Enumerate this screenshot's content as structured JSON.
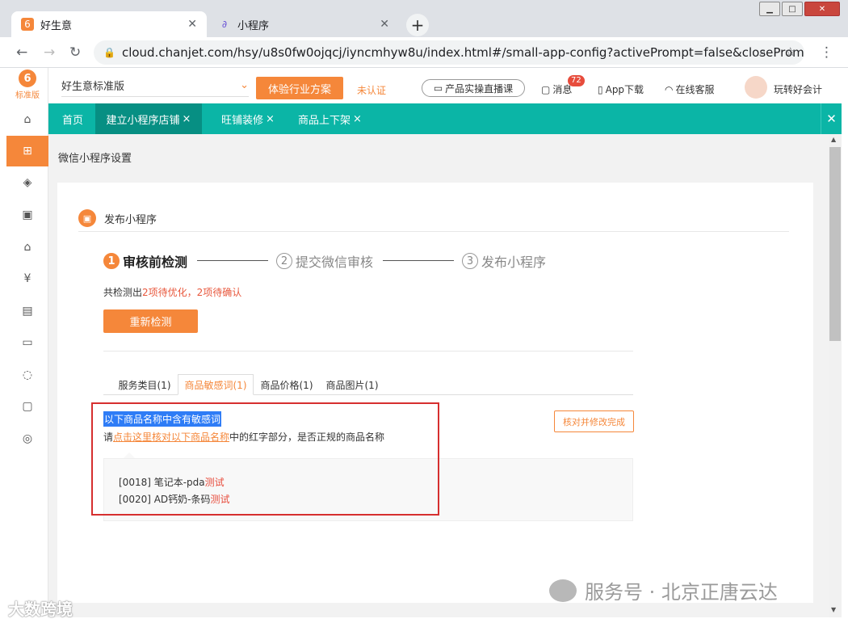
{
  "browser": {
    "tabs": [
      {
        "title": "好生意",
        "icon_text": "6"
      },
      {
        "title": "小程序",
        "icon_text": "∂"
      }
    ],
    "url": "cloud.chanjet.com/hsy/u8s0fw0ojqcj/iyncmhyw8u/index.html#/small-app-config?activePrompt=false&closeProm..."
  },
  "app": {
    "logo_label": "标准版",
    "edition": "好生意标准版",
    "trial_button": "体验行业方案",
    "unverified": "未认证",
    "live_course": "产品实操直播课",
    "messages": "消息",
    "message_count": "72",
    "app_download": "App下载",
    "online_service": "在线客服",
    "user_name": "玩转好会计"
  },
  "nav_tabs": [
    {
      "label": "首页"
    },
    {
      "label": "建立小程序店铺"
    },
    {
      "label": "旺铺装修"
    },
    {
      "label": "商品上下架"
    }
  ],
  "page": {
    "breadcrumb": "微信小程序设置",
    "section_title": "发布小程序",
    "steps": [
      {
        "num": "1",
        "label": "审核前检测"
      },
      {
        "num": "2",
        "label": "提交微信审核"
      },
      {
        "num": "3",
        "label": "发布小程序"
      }
    ],
    "summary_prefix": "共检测出",
    "summary_highlight": "2项待优化，2项待确认",
    "recheck_button": "重新检测",
    "subtabs": [
      {
        "label": "服务类目(1)"
      },
      {
        "label": "商品敏感词(1)"
      },
      {
        "label": "商品价格(1)"
      },
      {
        "label": "商品图片(1)"
      }
    ],
    "alert_title": "以下商品名称中含有敏感词",
    "hint_prefix": "请",
    "hint_link": "点击这里核对以下商品名称",
    "hint_suffix": "中的红字部分，是否正规的商品名称",
    "confirm_button": "核对并修改完成",
    "items": [
      {
        "prefix": "[0018] 笔记本-pda",
        "sensitive": "测试"
      },
      {
        "prefix": "[0020] AD钙奶-条码",
        "sensitive": "测试"
      }
    ]
  },
  "watermarks": {
    "bottom_left": "大数跨境",
    "bottom_right": "服务号 · 北京正唐云达"
  },
  "colors": {
    "accent": "#f5873a",
    "teal": "#0bb5a6",
    "highlight": "#2e7cf6",
    "alert_border": "#d62f2f"
  }
}
